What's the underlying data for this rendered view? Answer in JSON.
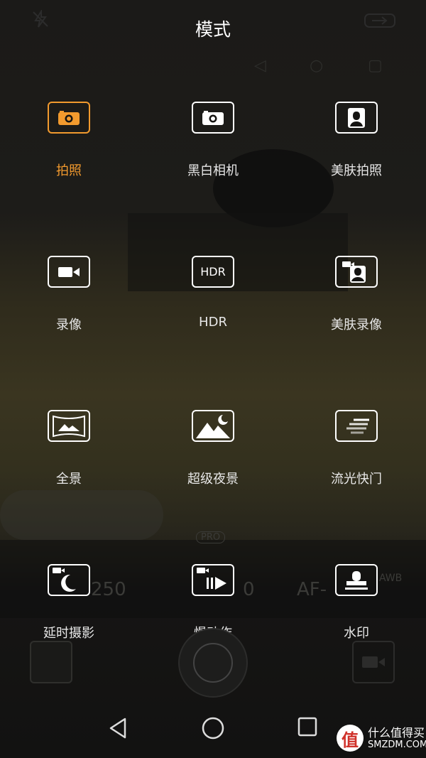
{
  "screen": {
    "title": "模式"
  },
  "modes": [
    {
      "label": "拍照",
      "icon": "camera-icon",
      "active": true
    },
    {
      "label": "黑白相机",
      "icon": "camera-icon"
    },
    {
      "label": "美肤拍照",
      "icon": "portrait-icon"
    },
    {
      "label": "录像",
      "icon": "video-camera-icon"
    },
    {
      "label": "HDR",
      "icon": "hdr-icon",
      "icon_text": "HDR"
    },
    {
      "label": "美肤录像",
      "icon": "portrait-video-icon"
    },
    {
      "label": "全景",
      "icon": "panorama-icon"
    },
    {
      "label": "超级夜景",
      "icon": "night-landscape-icon"
    },
    {
      "label": "流光快门",
      "icon": "light-trail-icon"
    },
    {
      "label": "延时摄影",
      "icon": "timelapse-icon"
    },
    {
      "label": "慢动作",
      "icon": "slow-motion-icon"
    },
    {
      "label": "水印",
      "icon": "watermark-stamp-icon"
    }
  ],
  "viewfinder_ghost": {
    "pro_badge": "PRO",
    "iso_value": "250",
    "ev_value": "0",
    "af_value": "AF-",
    "awb": "AWB"
  },
  "watermark": {
    "logo_char": "值",
    "line1": "什么值得买",
    "line2": "SMZDM.COM"
  },
  "colors": {
    "accent": "#f29a2e",
    "text": "#e8e8e8",
    "background": "#151412"
  }
}
